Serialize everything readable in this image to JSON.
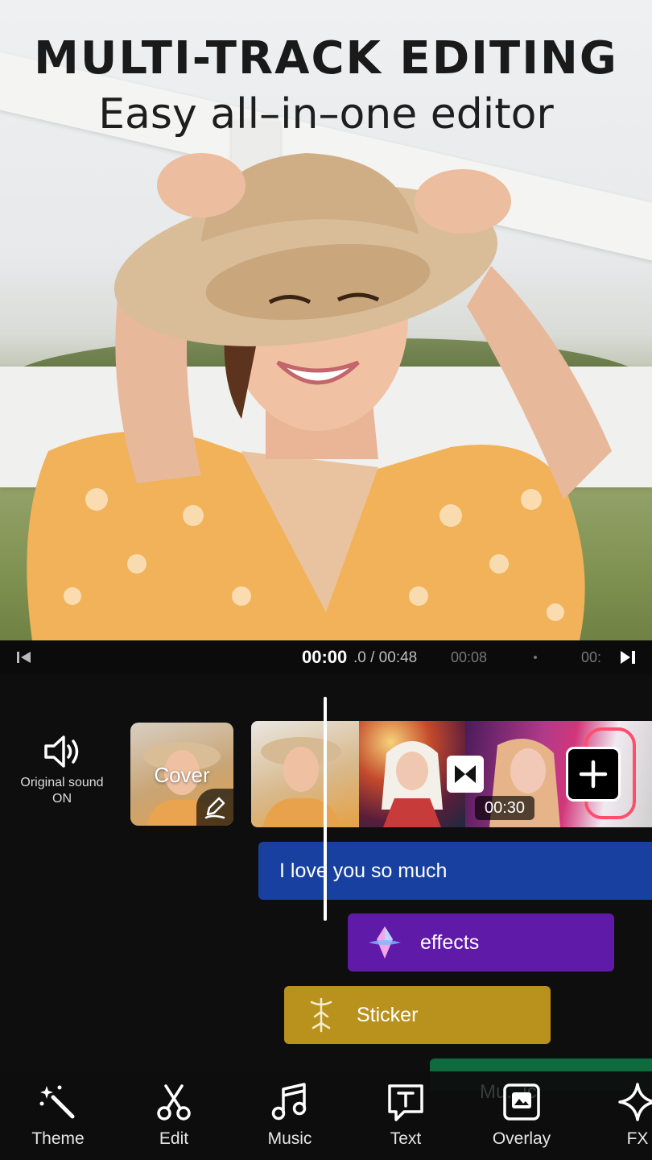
{
  "promo": {
    "headline": "MULTI-TRACK EDITING",
    "subline": "Easy all–in–one editor"
  },
  "timebar": {
    "current": "00:00",
    "total_suffix": ".0 / 00:48",
    "tick_1": "00:08",
    "tick_2": "00:",
    "skip_start_icon": "skip-start-icon",
    "play_next_icon": "play-next-icon"
  },
  "sound": {
    "label_line1": "Original sound",
    "label_line2": "ON",
    "icon": "speaker-icon"
  },
  "cover": {
    "label": "Cover",
    "edit_icon": "pen-icon"
  },
  "clips": {
    "duration": "00:30",
    "transition_icon": "bowtie-icon",
    "add_icon": "plus-icon"
  },
  "tracks": {
    "text_label": "I love you so much",
    "effects_label": "effects",
    "sticker_label": "Sticker",
    "music_ghost_label": "Mu...ic"
  },
  "toolbar": {
    "items": [
      {
        "label": "Theme",
        "icon": "magic-wand-icon"
      },
      {
        "label": "Edit",
        "icon": "scissors-icon"
      },
      {
        "label": "Music",
        "icon": "music-note-icon"
      },
      {
        "label": "Text",
        "icon": "text-bubble-icon"
      },
      {
        "label": "Overlay",
        "icon": "overlay-icon"
      },
      {
        "label": "FX",
        "icon": "sparkle-icon"
      }
    ]
  },
  "colors": {
    "text_track": "#1840a0",
    "effects_track": "#5f1aa8",
    "sticker_track": "#b9921e",
    "music_track": "#0f6a3e"
  }
}
